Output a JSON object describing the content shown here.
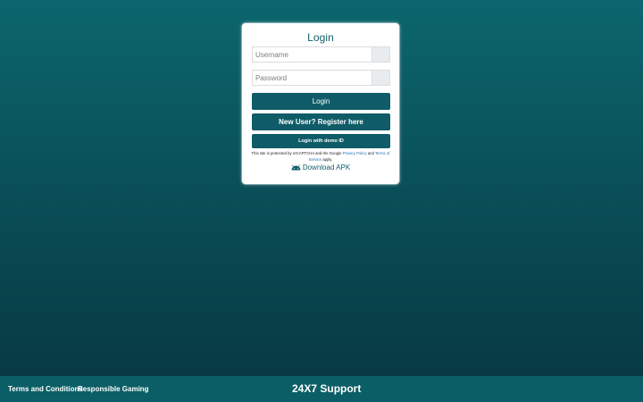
{
  "login_form": {
    "title": "Login",
    "username_placeholder": "Username",
    "password_placeholder": "Password",
    "login_button": "Login",
    "register_button": "New User? Register here",
    "demo_button": "Login with demo ID",
    "recaptcha": {
      "prefix": "This site is protected by reCAPTCHA and the Google",
      "privacy_link": "Privacy Policy",
      "and": "and",
      "terms_link": "Terms of Service",
      "suffix": "apply."
    },
    "download_label": "Download APK",
    "download_icon": "android-icon"
  },
  "footer": {
    "terms": "Terms and Conditions",
    "responsible": "Responsible Gaming",
    "support": "24X7 Support"
  },
  "colors": {
    "brand": "#0f5c68",
    "background_top": "#0c666d",
    "background_bottom": "#073740",
    "link": "#1a6fb5"
  }
}
